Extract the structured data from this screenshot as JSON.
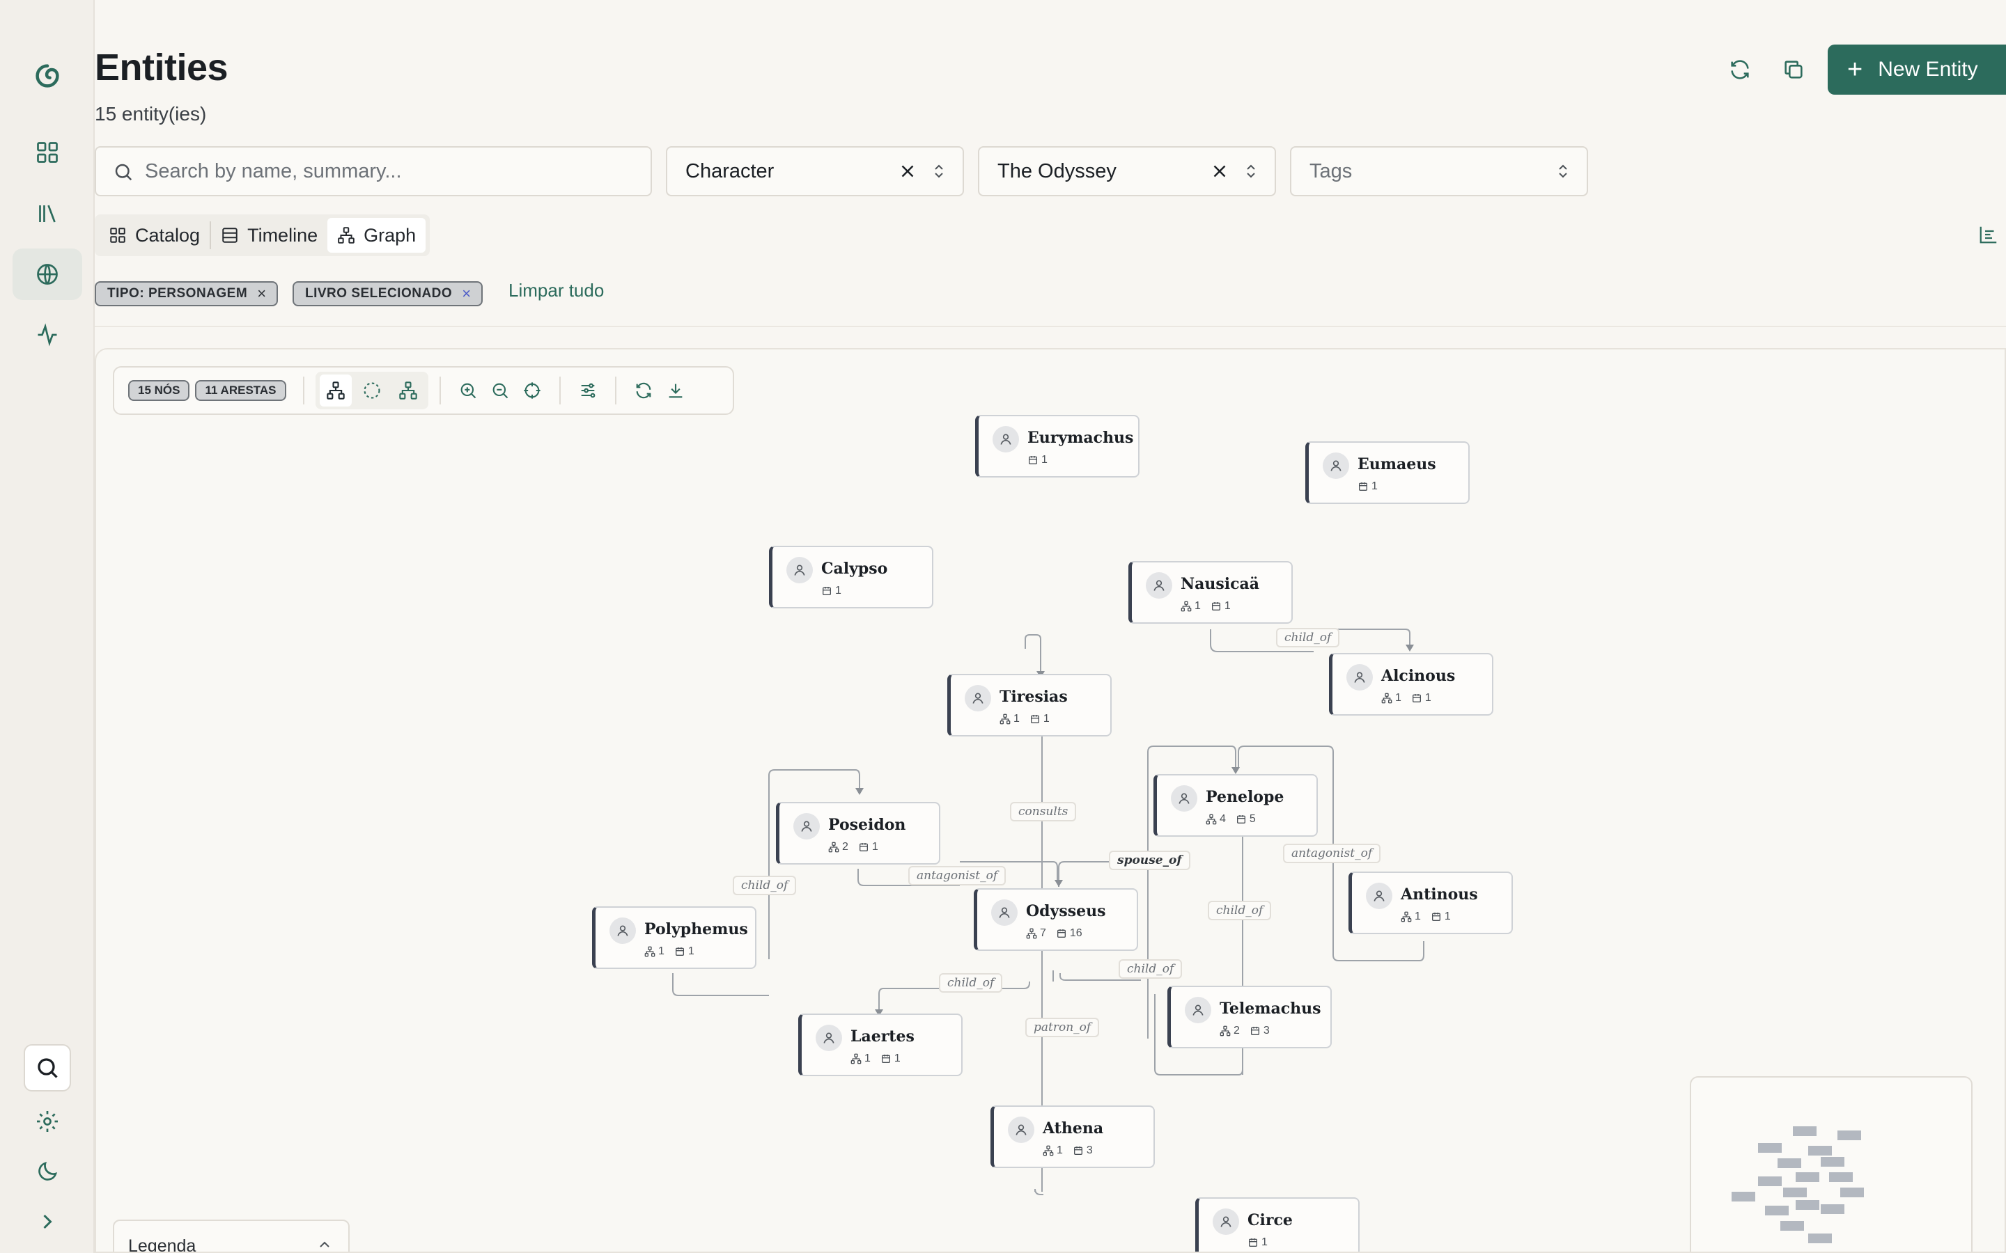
{
  "header": {
    "title": "Entities",
    "subtitle": "15 entity(ies)",
    "new_button_label": "New Entity"
  },
  "filters": {
    "search_placeholder": "Search by name, summary...",
    "type_value": "Character",
    "book_value": "The Odyssey",
    "tags_placeholder": "Tags"
  },
  "views": {
    "catalog": "Catalog",
    "timeline": "Timeline",
    "graph": "Graph",
    "active": "graph"
  },
  "active_filters": {
    "chips": [
      "TIPO: PERSONAGEM",
      "LIVRO SELECIONADO"
    ],
    "clear_all": "Limpar tudo"
  },
  "graph": {
    "nodes_badge": "15 NÓS",
    "edges_badge": "11 ARESTAS",
    "legend_label": "Legenda",
    "nodes": [
      {
        "name": "Eurymachus",
        "rel": null,
        "books": 1
      },
      {
        "name": "Eumaeus",
        "rel": null,
        "books": 1
      },
      {
        "name": "Calypso",
        "rel": null,
        "books": 1
      },
      {
        "name": "Nausicaä",
        "rel": 1,
        "books": 1
      },
      {
        "name": "Alcinous",
        "rel": 1,
        "books": 1
      },
      {
        "name": "Tiresias",
        "rel": 1,
        "books": 1
      },
      {
        "name": "Penelope",
        "rel": 4,
        "books": 5
      },
      {
        "name": "Poseidon",
        "rel": 2,
        "books": 1
      },
      {
        "name": "Antinous",
        "rel": 1,
        "books": 1
      },
      {
        "name": "Polyphemus",
        "rel": 1,
        "books": 1
      },
      {
        "name": "Odysseus",
        "rel": 7,
        "books": 16
      },
      {
        "name": "Telemachus",
        "rel": 2,
        "books": 3
      },
      {
        "name": "Laertes",
        "rel": 1,
        "books": 1
      },
      {
        "name": "Athena",
        "rel": 1,
        "books": 3
      },
      {
        "name": "Circe",
        "rel": null,
        "books": 1
      }
    ],
    "edge_labels": [
      "child_of",
      "consults",
      "antagonist_of",
      "spouse_of",
      "child_of",
      "antagonist_of",
      "child_of",
      "child_of",
      "child_of",
      "patron_of"
    ]
  },
  "colors": {
    "accent": "#2c6b5c",
    "node_border": "#3a4150",
    "background": "#f8f6f2"
  }
}
